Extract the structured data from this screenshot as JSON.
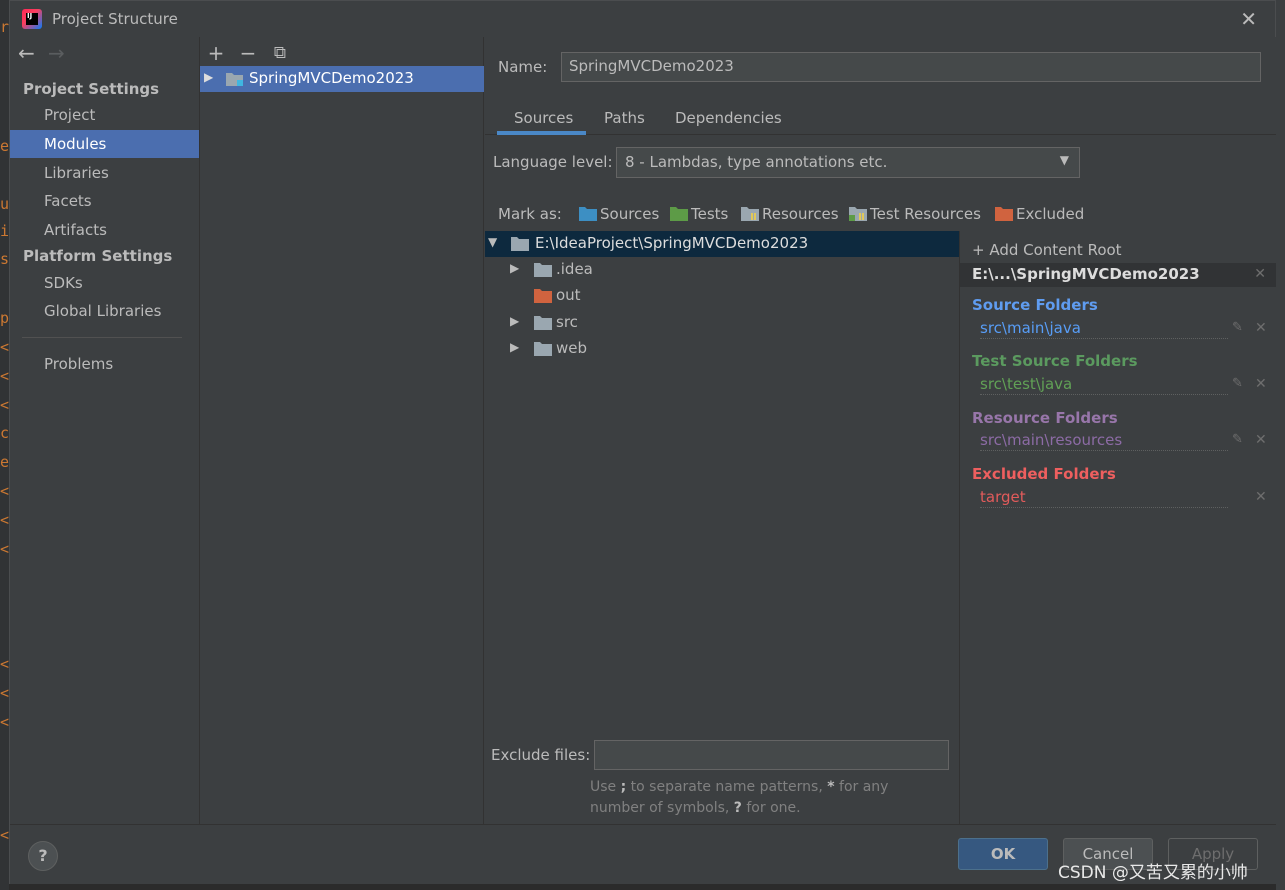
{
  "background": {
    "gutter_chars": [
      "r",
      "e",
      "u",
      "i",
      "s",
      "p",
      "<",
      "<",
      "<",
      "c",
      "e",
      "<",
      "<",
      "<",
      "<",
      "<",
      "<",
      "<"
    ],
    "gutter_color": "#cc7832"
  },
  "dialog": {
    "title": "Project Structure",
    "close_symbol": "✕"
  },
  "nav": {
    "back_symbol": "←",
    "forward_symbol": "→",
    "project_settings_header": "Project Settings",
    "project_items": [
      "Project",
      "Modules",
      "Libraries",
      "Facets",
      "Artifacts"
    ],
    "platform_settings_header": "Platform Settings",
    "platform_items": [
      "SDKs",
      "Global Libraries"
    ],
    "problems": "Problems",
    "selected": "Modules"
  },
  "module_list": {
    "toolbar": {
      "add": "+",
      "remove": "−",
      "copy": "⧉"
    },
    "modules": [
      "SpringMVCDemo2023"
    ]
  },
  "module": {
    "name_label": "Name:",
    "name_value": "SpringMVCDemo2023",
    "tabs": [
      "Sources",
      "Paths",
      "Dependencies"
    ],
    "active_tab": "Sources",
    "language_level_label": "Language level:",
    "language_level_value": "8 - Lambdas, type annotations etc.",
    "mark_as_label": "Mark as:",
    "mark_as": [
      {
        "label": "Sources",
        "color": "#3d8fc3"
      },
      {
        "label": "Tests",
        "color": "#5d9b47"
      },
      {
        "label": "Resources",
        "color": "#9aa7b0"
      },
      {
        "label": "Test Resources",
        "color": "#9aa7b0"
      },
      {
        "label": "Excluded",
        "color": "#d0633f"
      }
    ]
  },
  "tree": {
    "root": "E:\\IdeaProject\\SpringMVCDemo2023",
    "children": [
      {
        "label": ".idea",
        "expandable": true,
        "color": "#9aa7b0"
      },
      {
        "label": "out",
        "expandable": false,
        "color": "#d0633f"
      },
      {
        "label": "src",
        "expandable": true,
        "color": "#9aa7b0"
      },
      {
        "label": "web",
        "expandable": true,
        "color": "#9aa7b0"
      }
    ]
  },
  "exclude": {
    "label": "Exclude files:",
    "value": "",
    "hint_1": "Use ",
    "hint_semicolon": ";",
    "hint_2": " to separate name patterns, ",
    "hint_star": "*",
    "hint_3": " for any number of symbols, ",
    "hint_q": "?",
    "hint_4": " for one."
  },
  "content_roots": {
    "add_label": "Add Content Root",
    "root_label": "E:\\...\\SpringMVCDemo2023",
    "groups": [
      {
        "title": "Source Folders",
        "item": "src\\main\\java",
        "color": "#5f9cf0",
        "item_color": "#589df6",
        "editable": true
      },
      {
        "title": "Test Source Folders",
        "item": "src\\test\\java",
        "color": "#5b9a5f",
        "item_color": "#61a156",
        "editable": true
      },
      {
        "title": "Resource Folders",
        "item": "src\\main\\resources",
        "color": "#9876aa",
        "item_color": "#8c6ba5",
        "editable": true
      },
      {
        "title": "Excluded Folders",
        "item": "target",
        "color": "#ee5f5f",
        "item_color": "#e25b5b",
        "editable": false
      }
    ]
  },
  "buttons": {
    "help": "?",
    "ok": "OK",
    "cancel": "Cancel",
    "apply": "Apply"
  },
  "watermark": "CSDN @又苦又累的小帅"
}
